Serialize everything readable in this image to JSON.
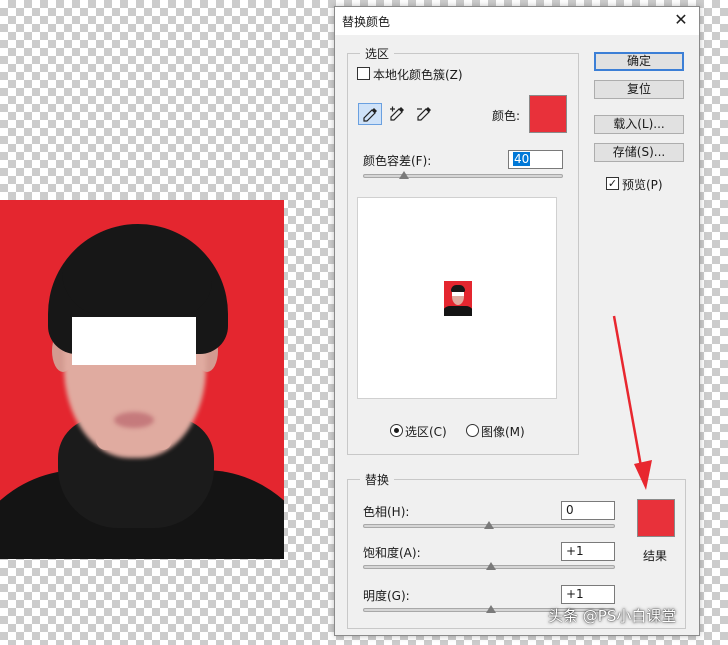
{
  "dialog": {
    "title": "替换颜色",
    "close_glyph": "✕",
    "selection": {
      "legend": "选区",
      "localized_clusters": {
        "label": "本地化颜色簇(Z)",
        "checked": false
      },
      "tools": [
        "eyedropper-icon",
        "eyedropper-plus-icon",
        "eyedropper-minus-icon"
      ],
      "color_label": "颜色:",
      "color": "#e8313a",
      "fuzziness": {
        "label": "颜色容差(F):",
        "value": "40",
        "slider_fraction": 0.2
      },
      "view_options": [
        {
          "label": "选区(C)",
          "selected": true
        },
        {
          "label": "图像(M)",
          "selected": false
        }
      ]
    },
    "buttons": {
      "ok": "确定",
      "reset": "复位",
      "load": "载入(L)...",
      "save": "存储(S)..."
    },
    "preview": {
      "label": "预览(P)",
      "checked": true
    },
    "replacement": {
      "legend": "替换",
      "hue": {
        "label": "色相(H):",
        "value": "0",
        "slider_fraction": 0.5
      },
      "saturation": {
        "label": "饱和度(A):",
        "value": "+1",
        "slider_fraction": 0.505
      },
      "lightness": {
        "label": "明度(G):",
        "value": "+1",
        "slider_fraction": 0.505
      },
      "result_label": "结果",
      "result_color": "#e8313a"
    }
  },
  "annotation": {
    "color": "#e8272f"
  },
  "watermark": "头条 @PS小白课堂",
  "colors": {
    "accent": "#3c7fd6",
    "photo_background": "#e4262f"
  }
}
